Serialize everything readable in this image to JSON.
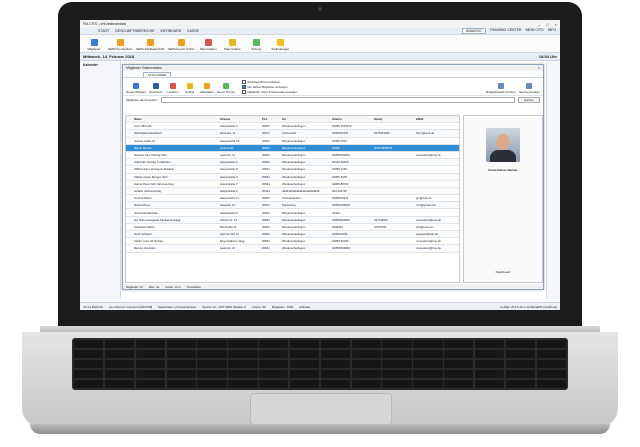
{
  "window": {
    "title": "FM-CITO - ehf-testmandant",
    "controls": [
      "–",
      "□",
      "×"
    ]
  },
  "menu": {
    "items": [
      "START",
      "GESCHÄFTSBEREICHE",
      "INFOBOARD",
      "KASSE"
    ],
    "right": [
      "INBASSO",
      "TRAINING CENTER",
      "MEIN CITO",
      "INFO"
    ]
  },
  "ribbon": {
    "buttons": [
      {
        "label": "Mitglieder",
        "color": "#3a7bd5"
      },
      {
        "label": "SEPA Kundenliste",
        "color": "#f0a020"
      },
      {
        "label": "SEPA Rücklastschrift",
        "color": "#f0a020"
      },
      {
        "label": "SEPA Export Archiv",
        "color": "#f0a020"
      },
      {
        "label": "Stammdaten",
        "color": "#d9534f"
      },
      {
        "label": "Stammsätze",
        "color": "#e8b820"
      },
      {
        "label": "Sitzung",
        "color": "#5cb85c"
      },
      {
        "label": "Stellmanager",
        "color": "#f0c020"
      }
    ]
  },
  "datebar": {
    "date": "Mittwoch, 14. Februar 2018",
    "time": "18:54 Uhr"
  },
  "leftpanel": {
    "header": "Kalender"
  },
  "dialog": {
    "title": "Mitglieder Stammdaten",
    "tab": "MITGLIEDER",
    "toolbar": [
      {
        "label": "Neues Mitglied",
        "color": "#3a7bd5"
      },
      {
        "label": "Speichern",
        "color": "#2b5aa8"
      },
      {
        "label": "Löschen",
        "color": "#d9534f"
      },
      {
        "label": "E-Mail",
        "color": "#e8b820"
      },
      {
        "label": "Aktivitäten",
        "color": "#f0a020"
      },
      {
        "label": "Neuer Termin",
        "color": "#5cb85c"
      }
    ],
    "checks": [
      {
        "label": "Suchbegriff hervorheben",
        "on": false
      },
      {
        "label": "Nur aktive Mitglieder anzeigen",
        "on": true
      },
      {
        "label": "Mitglieder ohne Trainpender anzeigen",
        "on": false
      }
    ],
    "right_buttons": [
      "Mitgliedskarte drucken",
      "Vertrag drucken"
    ],
    "search": {
      "label": "Mitglieder durchsuchen:",
      "value": "",
      "button": "Suchen"
    },
    "columns": [
      "Name",
      "Strasse",
      "PLZ",
      "Ort",
      "Telefon",
      "Handy",
      "EMail"
    ],
    "rows": [
      {
        "name": "Lenz Ulli Kelle",
        "street": "Hauptstraße 3",
        "plz": "26831",
        "city": "Wiedenerheitingen",
        "phone": "04955-4567876",
        "mobile": "",
        "email": ""
      },
      {
        "name": "Waltelfgast Hasselhorf",
        "street": "Moorstra. 11",
        "plz": "26671",
        "city": "Aschendorf",
        "phone": "04952/52451",
        "mobile": "0175934456",
        "email": "harry@web.de"
      },
      {
        "name": "Herbert Adam 22",
        "street": "Hauptstraße 19",
        "plz": "26831",
        "city": "Wiedenerheitingen",
        "phone": "04955-1515",
        "mobile": "",
        "email": ""
      },
      {
        "name": "Rainer Becker",
        "street": "Lindenhöfe",
        "plz": "26831",
        "city": "Wiedenerheitingen",
        "phone": "04955",
        "mobile": "0175-5555678",
        "email": ""
      },
      {
        "name": "Mariann Fam Vertrag 12M",
        "street": "Lawerstr. 3c",
        "plz": "26831",
        "city": "Wiedenerheitingen",
        "phone": "04955/934802",
        "mobile": "",
        "email": "mvoeckers@tme.de"
      },
      {
        "name": "Anja Fahr Vertrag zu Mariann",
        "street": "Hauptstraße 2",
        "plz": "26831",
        "city": "Wiedenerheitingen",
        "phone": "04412-45456",
        "mobile": "",
        "email": ""
      },
      {
        "name": "Wilfried Fam Vertrag zu Mariann",
        "street": "Hauptstraße 8",
        "plz": "26831",
        "city": "Wiedenerheitingen",
        "phone": "04955-2145",
        "mobile": "",
        "email": ""
      },
      {
        "name": "Sabine Guten Morgen Tarif",
        "street": "Hauptstraße 3",
        "plz": "26831",
        "city": "Wiedenerheitingen",
        "phone": "04955-5478",
        "mobile": "",
        "email": ""
      },
      {
        "name": "Hanna Peter halb Jahresvertrag",
        "street": "Hauptstraße 7",
        "plz": "26831",
        "city": "Wiedenerheitingen",
        "phone": "04955-88744",
        "mobile": "",
        "email": ""
      },
      {
        "name": "Johann Jahresvertrag",
        "street": "Hauptstraße 6",
        "plz": "25444",
        "city": "dddddddddddddddddddddddd",
        "phone": "044-154787",
        "mobile": "",
        "email": ""
      },
      {
        "name": "Gerhud Meyer",
        "street": "Hauptstraße 11",
        "plz": "26831",
        "city": "Ostrhauderfehn",
        "phone": "04955/64944",
        "mobile": "",
        "email": "gm@web.de"
      },
      {
        "name": "Martin Meyer",
        "street": "Hauptstr. 15",
        "plz": "26871",
        "city": "Papenburg",
        "phone": "04955/935802",
        "mobile": "",
        "email": "mm@gmail.com"
      },
      {
        "name": "Gama Monatstarife",
        "street": "Hauptstraße 9",
        "plz": "26831",
        "city": "Wiedenerheitingen",
        "phone": "44444",
        "mobile": "",
        "email": ""
      },
      {
        "name": "der Tost neuangelde Monkenvertragg",
        "street": "Hinrich str. 11",
        "plz": "26831",
        "city": "Wiedenerheitingen",
        "phone": "04955/934802",
        "mobile": "017132511",
        "email": "mvoeckers@tme.de"
      },
      {
        "name": "Sebastian Müller",
        "street": "Benstraße 11",
        "plz": "26831",
        "city": "Wiedenerheitingen",
        "phone": "0495544",
        "mobile": "01675944",
        "email": "info@lust.com"
      },
      {
        "name": "Gerd Schipper",
        "street": "Hamner Allc 11",
        "plz": "26831",
        "city": "Wiedenerheitingen",
        "phone": "0495512455",
        "mobile": "",
        "email": "gsheper@web.de"
      },
      {
        "name": "Steller unter 18 Vertrag",
        "street": "Meyerstabens 11gg",
        "plz": "26831",
        "city": "Wiedenerheitingen",
        "phone": "04955-54446",
        "mobile": "",
        "email": "mvoeckers@tme.de"
      },
      {
        "name": "Marcus Voeckers",
        "street": "Lawerstr. 3c",
        "plz": "26831",
        "city": "Wiedenerheitingen",
        "phone": "04955/934802",
        "mobile": "",
        "email": "mvoeckers@tme.de"
      }
    ],
    "selected_index": 3,
    "profile": {
      "name": "Firma Rainer Becker",
      "dashboard": "Dashboard"
    },
    "status": [
      "Mitglieder: 16",
      "Alter: 2a",
      "Suzan: 22 m",
      "Protokollen"
    ]
  },
  "statusbar": {
    "items": [
      "v6.4.2 Build 66",
      "Herr Marcus Voeckers [MA0708]",
      "Datenbank: ehf-testmandant",
      "Version-Nr.: ehf7 9000 Studios: 0",
      "Lizenz: 50",
      "Mitglieder: 1000",
      "Ultimate"
    ],
    "right": "mySQL v5.5.5-10.2.12-MariaDB (localhost)"
  }
}
